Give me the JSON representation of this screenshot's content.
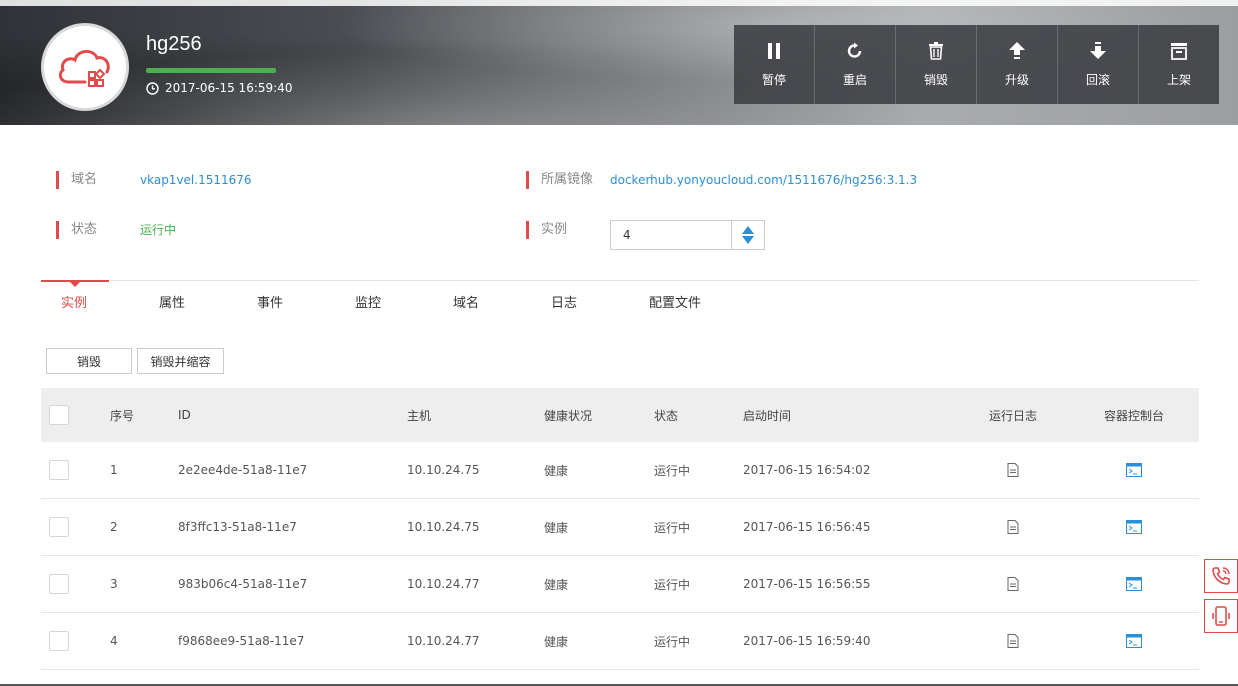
{
  "header": {
    "app_name": "hg256",
    "timestamp": "2017-06-15 16:59:40",
    "logo_icon": "cloud-app-icon",
    "actions": [
      {
        "label": "暂停",
        "icon": "pause-icon"
      },
      {
        "label": "重启",
        "icon": "restart-icon"
      },
      {
        "label": "销毁",
        "icon": "trash-icon"
      },
      {
        "label": "升级",
        "icon": "upgrade-icon"
      },
      {
        "label": "回滚",
        "icon": "rollback-icon"
      },
      {
        "label": "上架",
        "icon": "shelf-icon"
      }
    ]
  },
  "info": {
    "domain_label": "域名",
    "domain_value": "vkap1vel.1511676",
    "image_label": "所属镜像",
    "image_value": "dockerhub.yonyoucloud.com/1511676/hg256:3.1.3",
    "status_label": "状态",
    "status_value": "运行中",
    "instance_label": "实例",
    "instance_value": "4"
  },
  "tabs": [
    {
      "label": "实例",
      "active": true
    },
    {
      "label": "属性"
    },
    {
      "label": "事件"
    },
    {
      "label": "监控"
    },
    {
      "label": "域名"
    },
    {
      "label": "日志"
    },
    {
      "label": "配置文件"
    }
  ],
  "toolbar": {
    "destroy_label": "销毁",
    "destroy_scale_label": "销毁并缩容"
  },
  "table": {
    "headers": {
      "seq": "序号",
      "id": "ID",
      "host": "主机",
      "health": "健康状况",
      "status": "状态",
      "start_time": "启动时间",
      "log": "运行日志",
      "console": "容器控制台"
    },
    "rows": [
      {
        "seq": "1",
        "id": "2e2ee4de-51a8-11e7",
        "host": "10.10.24.75",
        "health": "健康",
        "status": "运行中",
        "start_time": "2017-06-15 16:54:02"
      },
      {
        "seq": "2",
        "id": "8f3ffc13-51a8-11e7",
        "host": "10.10.24.75",
        "health": "健康",
        "status": "运行中",
        "start_time": "2017-06-15 16:56:45"
      },
      {
        "seq": "3",
        "id": "983b06c4-51a8-11e7",
        "host": "10.10.24.77",
        "health": "健康",
        "status": "运行中",
        "start_time": "2017-06-15 16:56:55"
      },
      {
        "seq": "4",
        "id": "f9868ee9-51a8-11e7",
        "host": "10.10.24.77",
        "health": "健康",
        "status": "运行中",
        "start_time": "2017-06-15 16:59:40"
      }
    ]
  },
  "colors": {
    "accent_red": "#e14b4b",
    "link_blue": "#2a8fd7",
    "status_green": "#4cae4c"
  }
}
